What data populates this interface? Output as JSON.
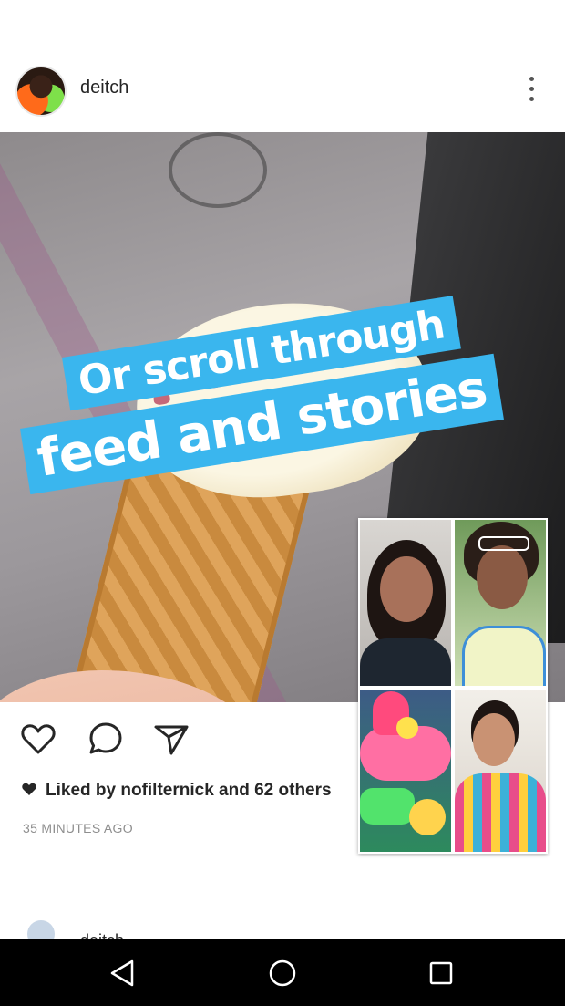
{
  "post": {
    "username": "deitch",
    "caption_line1": "Or scroll through",
    "caption_line2": "feed and stories",
    "likes_text": "Liked by nofilternick and 62 others",
    "timestamp": "35 MINUTES AGO"
  },
  "icons": {
    "more": "more-vertical-icon",
    "like": "heart-icon",
    "comment": "comment-bubble-icon",
    "share": "send-icon",
    "liked": "heart-filled-icon"
  },
  "next_post": {
    "username": "deitch"
  },
  "nav": {
    "back": "back-triangle-icon",
    "home": "home-circle-icon",
    "recents": "recents-square-icon"
  },
  "colors": {
    "sticker_bg": "#3ab6ee",
    "text_primary": "#262626",
    "text_secondary": "#8e8e8e"
  }
}
